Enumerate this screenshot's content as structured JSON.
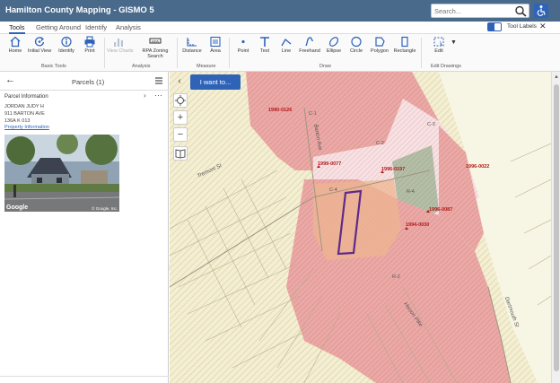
{
  "app": {
    "title": "Hamilton County Mapping - GISMO 5",
    "search_placeholder": "Search..."
  },
  "tabs": [
    {
      "label": "Tools",
      "active": true
    },
    {
      "label": "Getting Around",
      "active": false
    },
    {
      "label": "Identify",
      "active": false
    },
    {
      "label": "Analysis",
      "active": false
    }
  ],
  "tool_labels": {
    "label": "Tool Labels",
    "enabled": true
  },
  "ribbon": {
    "basic_tools": {
      "label": "Basic Tools",
      "buttons": [
        {
          "label": "Home",
          "icon": "home-icon"
        },
        {
          "label": "Initial View",
          "icon": "initial-view-icon"
        },
        {
          "label": "Identify",
          "icon": "identify-icon"
        },
        {
          "label": "Print",
          "icon": "print-icon"
        }
      ]
    },
    "analysis": {
      "label": "Analysis",
      "buttons": [
        {
          "label": "View Charts",
          "icon": "chart-icon",
          "disabled": true
        },
        {
          "label": "RPA Zoning Search",
          "icon": "zoning-search-icon"
        }
      ]
    },
    "measure": {
      "label": "Measure",
      "buttons": [
        {
          "label": "Distance",
          "icon": "distance-icon"
        },
        {
          "label": "Area",
          "icon": "area-icon"
        }
      ]
    },
    "draw": {
      "label": "Draw",
      "buttons": [
        {
          "label": "Point",
          "icon": "point-icon"
        },
        {
          "label": "Text",
          "icon": "text-icon"
        },
        {
          "label": "Line",
          "icon": "line-icon"
        },
        {
          "label": "Freehand",
          "icon": "freehand-icon"
        },
        {
          "label": "Ellipse",
          "icon": "ellipse-icon"
        },
        {
          "label": "Circle",
          "icon": "circle-icon"
        },
        {
          "label": "Polygon",
          "icon": "polygon-icon"
        },
        {
          "label": "Rectangle",
          "icon": "rectangle-icon"
        }
      ]
    },
    "edit_drawings": {
      "label": "Edit Drawings",
      "buttons": [
        {
          "label": "Edit",
          "icon": "edit-icon"
        }
      ]
    }
  },
  "panel": {
    "title": "Parcels (1)",
    "section_title": "Parcel Information",
    "owner": "JORDAN JUDY H",
    "address": "911 BARTON AVE",
    "parcel_id": "136A K 013",
    "link_label": "Property Information",
    "photo_brand": "Google",
    "photo_copyright": "© Google, Inc."
  },
  "map": {
    "i_want_to": "I want to...",
    "case_labels": [
      "1990-0126",
      "1999-0077",
      "1996-0197",
      "1996-0087",
      "1994-0030",
      "1996-0022"
    ],
    "zone_labels": [
      "C-1",
      "C-2",
      "C-3",
      "R-4",
      "R-2",
      "R-4",
      "C-4"
    ],
    "street_labels": [
      "Barton Ave",
      "Tremont St",
      "Dartmouth St",
      "Hixson Pike"
    ]
  },
  "colors": {
    "header": "#4a6a8c",
    "accent": "#2e63b8",
    "zone_red": "#e79a9a",
    "zone_pink": "#f7d8dc",
    "zone_tan": "#f0e6b6",
    "zone_green": "#a9b79c",
    "selected_parcel": "#5c2a8a"
  }
}
